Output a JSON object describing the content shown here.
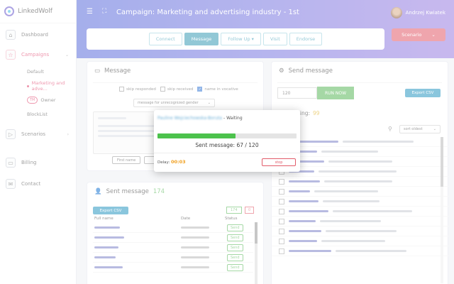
{
  "app": {
    "name": "LinkedWolf"
  },
  "sidebar": {
    "items": [
      {
        "label": "Dashboard",
        "icon": "home-icon"
      },
      {
        "label": "Campaigns",
        "icon": "star-icon"
      },
      {
        "label": "Scenarios",
        "icon": "play-icon"
      },
      {
        "label": "Billing",
        "icon": "billing-icon"
      },
      {
        "label": "Contact",
        "icon": "mail-icon"
      }
    ],
    "sub": {
      "default": "Default",
      "marketing": "Marketing and adve...",
      "owner_badge": "TM",
      "owner": "Owner",
      "blocklist": "BlockList"
    }
  },
  "header": {
    "title": "Campaign: Marketing and advertising industry - 1st",
    "user": "Andrzej Kwiatek"
  },
  "actions": {
    "connect": "Connect",
    "message": "Message",
    "follow_up": "Follow Up ▾",
    "visit": "Visit",
    "endorse": "Endorse",
    "scenario": "Scenario"
  },
  "message_card": {
    "title": "Message",
    "skip_responded": "skip responded",
    "skip_received": "skip received",
    "name_vocative": "name in vocative",
    "gender_select": "message for unrecognized gender",
    "first_name": "First name"
  },
  "sent_card": {
    "title": "Sent message",
    "count": "174",
    "export": "Export CSV",
    "badge1": "174",
    "badge2": "0",
    "col_name": "Full name",
    "col_date": "Date",
    "col_status": "Status",
    "send_label": "Send"
  },
  "send_card": {
    "title": "Send message",
    "input_value": "120",
    "run_now": "RUN NOW",
    "export": "Export CSV",
    "waiting_label": "Waiting:",
    "waiting_count": "99",
    "sort": "sort oldest"
  },
  "modal": {
    "name": "Pauline Wojciechowska-Boruta",
    "status": "- Waiting",
    "progress": 0.56,
    "sent_text": "Sent message: 67 / 120",
    "delay_label": "Delay:",
    "delay_value": "00:03",
    "stop": "stop"
  }
}
